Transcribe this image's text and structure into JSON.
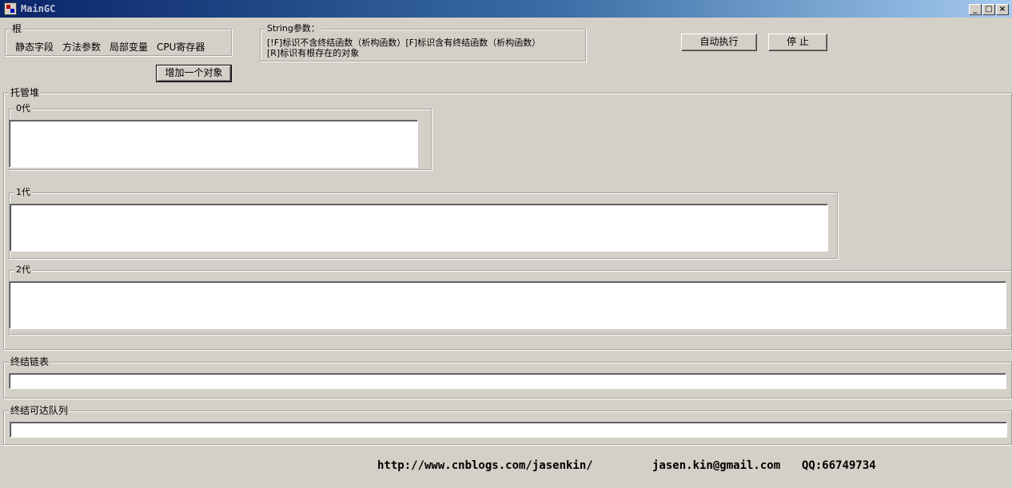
{
  "window": {
    "title": "MainGC",
    "minimize_label": "_",
    "maximize_label": "□",
    "close_label": "×"
  },
  "roots": {
    "title": "根",
    "items": [
      "静态字段",
      "方法参数",
      "局部变量",
      "CPU寄存器"
    ]
  },
  "string_params": {
    "title": "String参数：",
    "line1": "[!F]标识不含终结函数（析构函数）[F]标识含有终结函数（析构函数）",
    "line2": "[R]标识有根存在的对象"
  },
  "buttons": {
    "auto_run": "自动执行",
    "stop": "停 止",
    "add_object": "增加一个对象"
  },
  "managed_heap": {
    "title": "托管堆",
    "gen0": "0代",
    "gen1": "1代",
    "gen2": "2代"
  },
  "finalization_list": {
    "title": "终结链表"
  },
  "freachable_queue": {
    "title": "终结可达队列"
  },
  "footer": {
    "url": "http://www.cnblogs.com/jasenkin/",
    "email": "jasen.kin@gmail.com",
    "qq": "QQ:66749734"
  }
}
